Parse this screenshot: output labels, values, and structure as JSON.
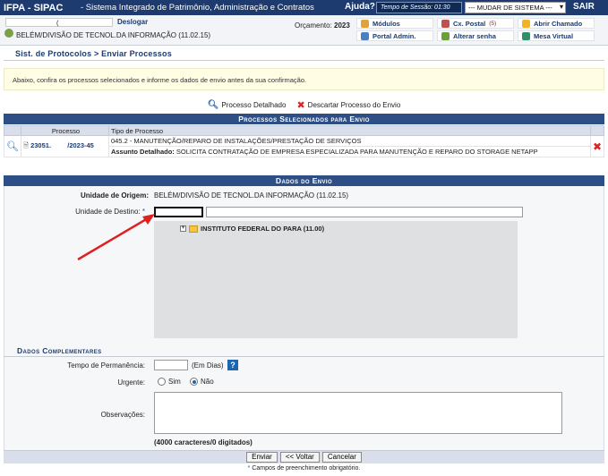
{
  "topbar": {
    "system": "IFPA - SIPAC",
    "subtitle": "- Sistema Integrado de Patrimônio, Administração e Contratos",
    "help": "Ajuda?",
    "session_label": "Tempo de Sessão: 01:30",
    "system_select": "--- MUDAR DE SISTEMA ---",
    "logout": "SAIR"
  },
  "user": {
    "name_fragment": "(",
    "logout_link": "Deslogar",
    "unit": "BELÉM/DIVISÃO DE TECNOL.DA INFORMAÇÃO (11.02.15)",
    "budget_label": "Orçamento:",
    "budget_year": "2023"
  },
  "menu": {
    "modules": "Módulos",
    "mailbox": "Cx. Postal",
    "mailbox_count": "(5)",
    "open_ticket": "Abrir Chamado",
    "admin_portal": "Portal Admin.",
    "change_password": "Alterar senha",
    "virtual_desk": "Mesa Virtual"
  },
  "breadcrumb": "Sist. de Protocolos > Enviar Processos",
  "info_message": "Abaixo, confira os processos selecionados e informe os dados de envio antes da sua confirmação.",
  "legend": {
    "detail": "Processo Detalhado",
    "discard": "Descartar Processo do Envio"
  },
  "selected": {
    "title": "Processos Selecionados para Envio",
    "col_process": "Processo",
    "col_type": "Tipo de Processo",
    "rows": [
      {
        "number_a": "23051.",
        "number_b": "/2023-45",
        "type": "045.2 - MANUTENÇÃO/REPARO DE INSTALAÇÕES/PRESTAÇÃO DE SERVIÇOS",
        "subject_label": "Assunto Detalhado:",
        "subject": "SOLICITA CONTRATAÇÃO DE EMPRESA ESPECIALIZADA PARA MANUTENÇÃO E REPARO DO STORAGE NETAPP"
      }
    ]
  },
  "envio": {
    "title": "Dados do Envio",
    "origin_label": "Unidade de Origem:",
    "origin_value": "BELÉM/DIVISÃO DE TECNOL.DA INFORMAÇÃO (11.02.15)",
    "dest_label": "Unidade de Destino:",
    "tree_root": "INSTITUTO FEDERAL DO PARA (11.00)"
  },
  "complementares": {
    "title": "Dados Complementares",
    "permanence_label": "Tempo de Permanência:",
    "permanence_unit": "(Em Dias)",
    "urgent_label": "Urgente:",
    "yes": "Sim",
    "no": "Não",
    "urgent_value": "Não",
    "obs_label": "Observações:",
    "counter": "(4000 caracteres/0 digitados)"
  },
  "buttons": {
    "send": "Enviar",
    "back": "<< Voltar",
    "cancel": "Cancelar"
  },
  "required_note": "Campos de preenchimento obrigatório.",
  "colors": {
    "header_blue": "#1d3b6e",
    "section_blue": "#2d4f86",
    "annotation_red": "#e02020"
  }
}
